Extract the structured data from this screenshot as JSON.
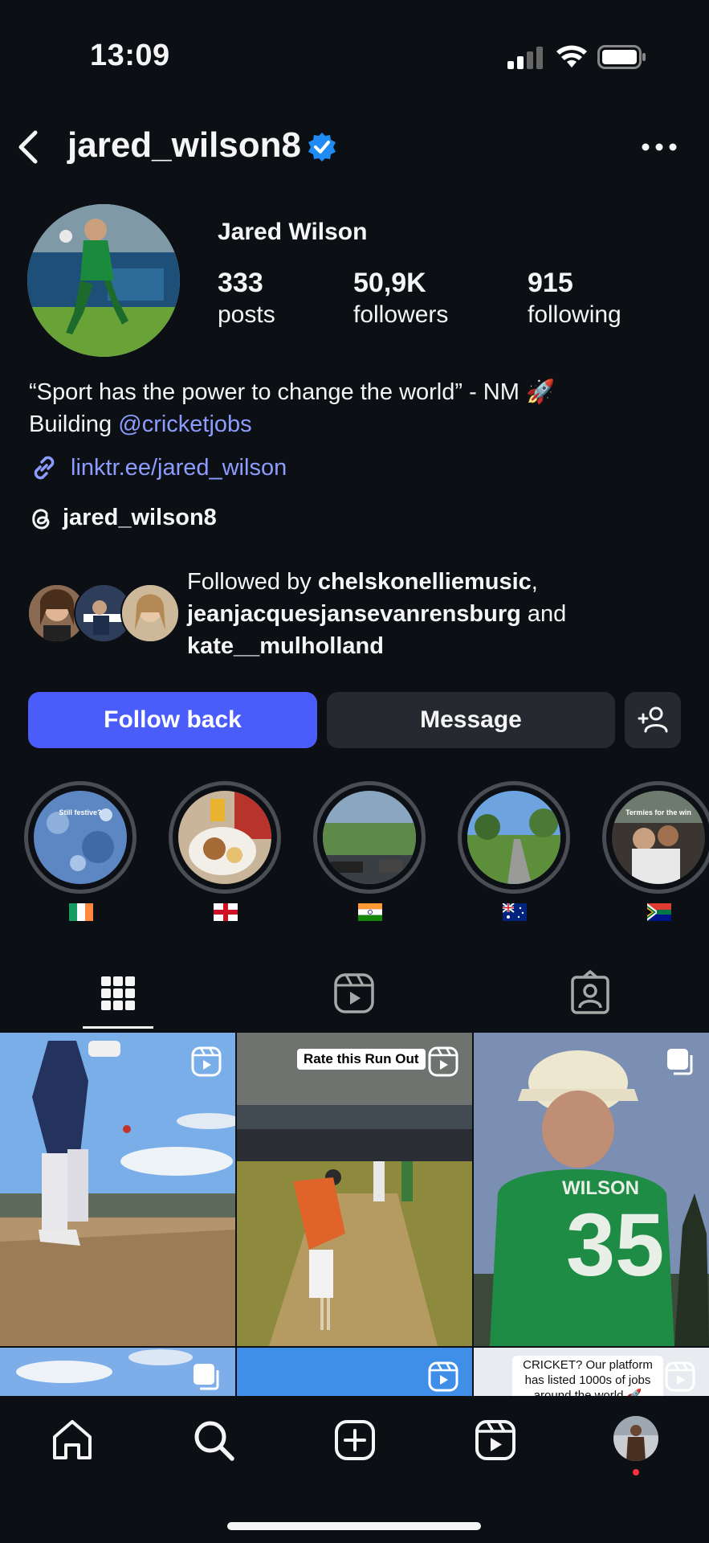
{
  "status_bar": {
    "time": "13:09"
  },
  "header": {
    "username": "jared_wilson8"
  },
  "profile": {
    "full_name": "Jared Wilson",
    "stats": [
      {
        "value": "333",
        "label": "posts"
      },
      {
        "value": "50,9K",
        "label": "followers"
      },
      {
        "value": "915",
        "label": "following"
      }
    ],
    "bio_line1": "“Sport has the power to change the world” - NM 🚀",
    "bio_building": "Building ",
    "bio_mention": "@cricketjobs",
    "link": "linktr.ee/jared_wilson",
    "threads_handle": "jared_wilson8"
  },
  "followed_by": {
    "prefix": "Followed by ",
    "user1": "chelskonelliemusic",
    "sep": ",",
    "user2": "jeanjacquesjansevanrensburg",
    "and": " and",
    "user3": "kate__mulholland"
  },
  "buttons": {
    "follow_back": "Follow back",
    "message": "Message"
  },
  "highlights": [
    {
      "flag": "ireland",
      "cover_text": "Still festive?"
    },
    {
      "flag": "england",
      "cover_text": ""
    },
    {
      "flag": "india",
      "cover_text": ""
    },
    {
      "flag": "australia",
      "cover_text": ""
    },
    {
      "flag": "south-africa",
      "cover_text": "Termies for the win"
    }
  ],
  "grid": {
    "post2_caption": "Rate this Run Out",
    "post3_jersey_name": "WILSON",
    "post3_jersey_number": "35",
    "post6_promo": "CRICKET? Our platform has listed 1000s of jobs around the world 🚀"
  },
  "colors": {
    "background": "#0c1014",
    "accent": "#4a5dfa",
    "link": "#8c9cff",
    "button_secondary": "#26292f"
  }
}
